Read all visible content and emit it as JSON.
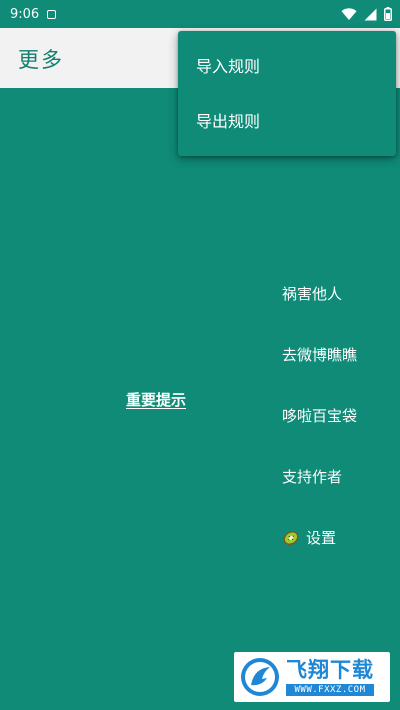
{
  "status_bar": {
    "time": "9:06",
    "icons": [
      "notification-icon",
      "wifi-icon",
      "signal-icon",
      "battery-icon"
    ]
  },
  "app_bar": {
    "title": "更多"
  },
  "overflow_menu": {
    "items": [
      {
        "label": "导入规则"
      },
      {
        "label": "导出规则"
      }
    ]
  },
  "main": {
    "notice_link": "重要提示",
    "side_items": [
      {
        "label": "祸害他人"
      },
      {
        "label": "去微博瞧瞧"
      },
      {
        "label": "哆啦百宝袋"
      },
      {
        "label": "支持作者"
      },
      {
        "label": "设置",
        "icon": "kiwi-icon"
      }
    ]
  },
  "watermark": {
    "brand": "飞翔下载",
    "domain": "WWW.FXXZ.COM"
  },
  "colors": {
    "primary": "#0f8b78",
    "app_bar_bg": "#f2f2f2",
    "title_text": "#0f7f6d",
    "watermark_blue": "#1e88d6"
  }
}
